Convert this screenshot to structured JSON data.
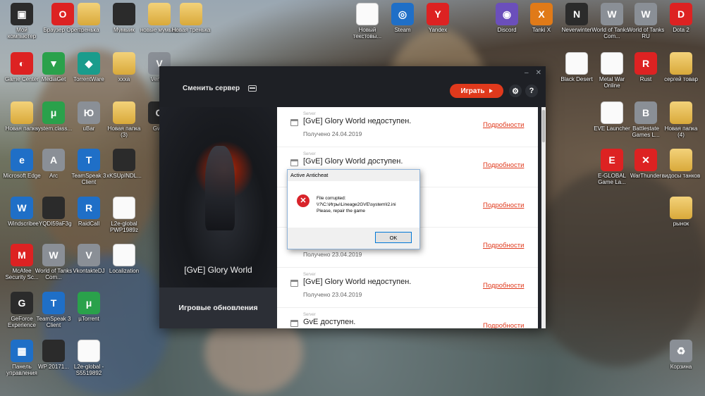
{
  "desktop": {
    "icons": [
      {
        "label": "Мой компьютер",
        "glyph": "▣",
        "style": "g-dark",
        "name": "my-computer-icon"
      },
      {
        "label": "Браузер Opera",
        "glyph": "O",
        "style": "g-red",
        "name": "opera-icon"
      },
      {
        "label": "тренька",
        "glyph": "",
        "style": "g-folder",
        "name": "folder-icon"
      },
      {
        "label": "Мумыик",
        "glyph": "",
        "style": "g-dark",
        "name": "file-icon"
      },
      {
        "label": "новые мумыки",
        "glyph": "",
        "style": "g-folder",
        "name": "folder-icon"
      },
      {
        "label": "Новая тренька",
        "glyph": "",
        "style": "g-folder",
        "name": "folder-icon"
      },
      {
        "label": "Новый текстовы...",
        "glyph": "",
        "style": "g-doc",
        "name": "text-document-icon"
      },
      {
        "label": "Steam",
        "glyph": "◎",
        "style": "g-blue",
        "name": "steam-icon"
      },
      {
        "label": "Yandex",
        "glyph": "Y",
        "style": "g-red",
        "name": "yandex-icon"
      },
      {
        "label": "Discord",
        "glyph": "◉",
        "style": "g-purple",
        "name": "discord-icon"
      },
      {
        "label": "Tanki X",
        "glyph": "X",
        "style": "g-orange",
        "name": "tanki-x-icon"
      },
      {
        "label": "Neverwinter",
        "glyph": "N",
        "style": "g-dark",
        "name": "neverwinter-icon"
      },
      {
        "label": "World of Tanks - Com...",
        "glyph": "W",
        "style": "g-gray",
        "name": "world-of-tanks-icon"
      },
      {
        "label": "World of Tanks RU",
        "glyph": "W",
        "style": "g-gray",
        "name": "world-of-tanks-ru-icon"
      },
      {
        "label": "Dota 2",
        "glyph": "D",
        "style": "g-red",
        "name": "dota2-icon"
      },
      {
        "label": "Game Center",
        "glyph": "◐",
        "style": "g-red",
        "name": "game-center-icon"
      },
      {
        "label": "MediaGet",
        "glyph": "▼",
        "style": "g-green",
        "name": "mediaget-icon"
      },
      {
        "label": "TorrentWare",
        "glyph": "◆",
        "style": "g-teal",
        "name": "torrentware-icon"
      },
      {
        "label": "xxxa",
        "glyph": "",
        "style": "g-folder",
        "name": "folder-icon"
      },
      {
        "label": "Venti...",
        "glyph": "V",
        "style": "g-gray",
        "name": "ventrilo-icon"
      },
      {
        "label": "Black Desert",
        "glyph": "",
        "style": "g-doc",
        "name": "black-desert-icon"
      },
      {
        "label": "Metal War Online",
        "glyph": "",
        "style": "g-doc",
        "name": "metal-war-online-icon"
      },
      {
        "label": "Rust",
        "glyph": "R",
        "style": "g-red",
        "name": "rust-icon"
      },
      {
        "label": "сергей товар",
        "glyph": "",
        "style": "g-folder",
        "name": "folder-icon"
      },
      {
        "label": "Новая папка",
        "glyph": "",
        "style": "g-folder",
        "name": "folder-icon"
      },
      {
        "label": "system.class...",
        "glyph": "μ",
        "style": "g-green",
        "name": "utorrent-icon"
      },
      {
        "label": "uBar",
        "glyph": "Ю",
        "style": "g-gray",
        "name": "ubar-icon"
      },
      {
        "label": "Новая папка (3)",
        "glyph": "",
        "style": "g-folder",
        "name": "folder-icon"
      },
      {
        "label": "Gw...",
        "glyph": "G",
        "style": "g-dark",
        "name": "gw-icon"
      },
      {
        "label": "EVE Launcher",
        "glyph": "",
        "style": "g-doc",
        "name": "eve-launcher-icon"
      },
      {
        "label": "Battlestate Games L...",
        "glyph": "B",
        "style": "g-gray",
        "name": "battlestate-icon"
      },
      {
        "label": "Новая папка (4)",
        "glyph": "",
        "style": "g-folder",
        "name": "folder-icon"
      },
      {
        "label": "Microsoft Edge",
        "glyph": "e",
        "style": "g-blue",
        "name": "edge-icon"
      },
      {
        "label": "Arc",
        "glyph": "A",
        "style": "g-gray",
        "name": "arc-icon"
      },
      {
        "label": "TeamSpeak 3 Client",
        "glyph": "T",
        "style": "g-blue",
        "name": "teamspeak-icon"
      },
      {
        "label": "xKSUpINDL...",
        "glyph": "",
        "style": "g-dark",
        "name": "file-icon"
      },
      {
        "label": "E-GLOBAL Game La...",
        "glyph": "E",
        "style": "g-red",
        "name": "eglobal-icon"
      },
      {
        "label": "WarThunder",
        "glyph": "✕",
        "style": "g-red",
        "name": "warthunder-icon"
      },
      {
        "label": "видосы танков",
        "glyph": "",
        "style": "g-folder",
        "name": "folder-icon"
      },
      {
        "label": "Windscribe",
        "glyph": "W",
        "style": "g-blue",
        "name": "windscribe-icon"
      },
      {
        "label": "eYQDI59aF3g",
        "glyph": "",
        "style": "g-dark",
        "name": "file-icon"
      },
      {
        "label": "RaidCall",
        "glyph": "R",
        "style": "g-blue",
        "name": "raidcall-icon"
      },
      {
        "label": "L2e-global PWP1989z",
        "glyph": "",
        "style": "g-doc",
        "name": "document-icon"
      },
      {
        "label": "рынок",
        "glyph": "",
        "style": "g-folder",
        "name": "folder-icon"
      },
      {
        "label": "McAfee Security Sc...",
        "glyph": "M",
        "style": "g-red",
        "name": "mcafee-icon"
      },
      {
        "label": "World of Tanks Com...",
        "glyph": "W",
        "style": "g-gray",
        "name": "world-of-tanks-icon"
      },
      {
        "label": "VkontakteDJ",
        "glyph": "V",
        "style": "g-gray",
        "name": "vkontakte-dj-icon"
      },
      {
        "label": "Localization",
        "glyph": "",
        "style": "g-doc",
        "name": "localization-icon"
      },
      {
        "label": "GeForce Experience",
        "glyph": "G",
        "style": "g-dark",
        "name": "geforce-icon"
      },
      {
        "label": "TeamSpeak 3 Client",
        "glyph": "T",
        "style": "g-blue",
        "name": "teamspeak-icon"
      },
      {
        "label": "µTorrent",
        "glyph": "μ",
        "style": "g-green",
        "name": "utorrent-icon"
      },
      {
        "label": "Панель управления",
        "glyph": "▦",
        "style": "g-blue",
        "name": "control-panel-icon"
      },
      {
        "label": "WP 20171...",
        "glyph": "",
        "style": "g-dark",
        "name": "file-icon"
      },
      {
        "label": "L2e-global - S5519892",
        "glyph": "",
        "style": "g-doc",
        "name": "document-icon"
      },
      {
        "label": "Корзина",
        "glyph": "♻",
        "style": "g-gray",
        "name": "recycle-bin-icon"
      }
    ]
  },
  "launcher": {
    "controls": {
      "minimize": "–",
      "close": "✕"
    },
    "server_switch_label": "Сменить сервер",
    "play_label": "Играть",
    "gear_glyph": "⚙",
    "help_glyph": "?",
    "server_name": "[GvE] Glory World",
    "updates_tab": "Игровые обновления",
    "news": [
      {
        "kind": "Server",
        "title": "[GvE] Glory World недоступен.",
        "date": "Получено 24.04.2019",
        "more": "Подробности"
      },
      {
        "kind": "Server",
        "title": "[GvE] Glory World доступен.",
        "date": "",
        "more": "Подробности"
      },
      {
        "kind": "",
        "title": "",
        "date": "",
        "more": "Подробности"
      },
      {
        "kind": "",
        "title": "",
        "date": "Получено 23.04.2019",
        "more": "Подробности"
      },
      {
        "kind": "Server",
        "title": "[GvE] Glory World недоступен.",
        "date": "Получено 23.04.2019",
        "more": "Подробности"
      },
      {
        "kind": "Server",
        "title": "GvE доступен.",
        "date": "",
        "more": "Подробности"
      }
    ]
  },
  "dialog": {
    "title": "Active Anticheat",
    "error_glyph": "✕",
    "message_line1": "File corrupted:",
    "message_line2": "\\\\?\\C:\\Игры\\Lineage2GVE\\system\\l2.ini",
    "message_line3": "Please, repair the game",
    "ok_label": "OK"
  }
}
